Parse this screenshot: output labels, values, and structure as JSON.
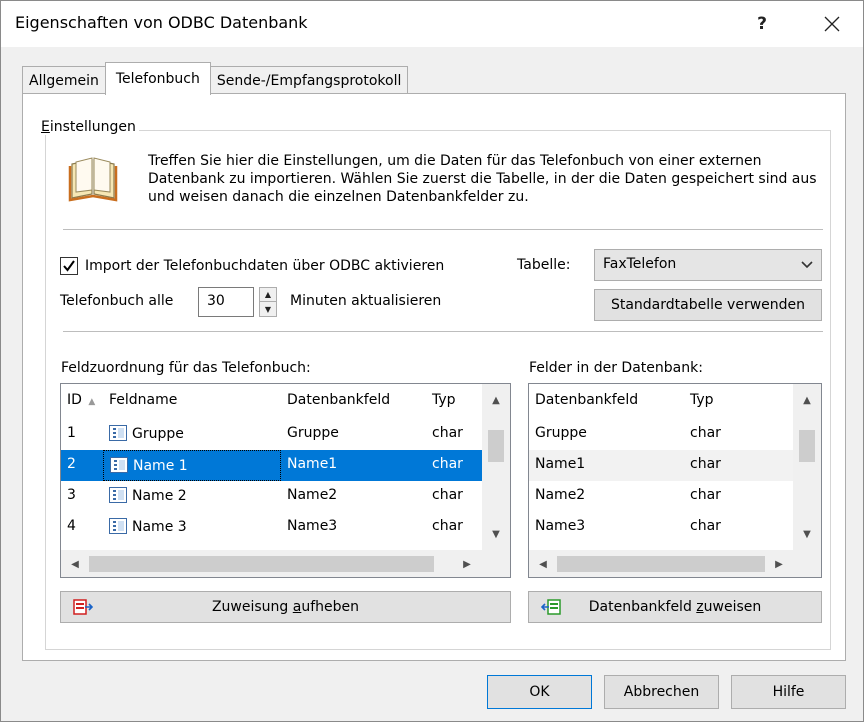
{
  "window": {
    "title": "Eigenschaften von ODBC Datenbank",
    "help_glyph": "?",
    "close_glyph": "✕"
  },
  "tabs": [
    {
      "label": "Allgemein",
      "active": false
    },
    {
      "label": "Telefonbuch",
      "active": true
    },
    {
      "label": "Sende-/Empfangsprotokoll",
      "active": false
    }
  ],
  "settings": {
    "group_title": "Einstellungen",
    "description": "Treffen Sie hier die Einstellungen, um die Daten für das Telefonbuch von einer externen Datenbank zu importieren. Wählen Sie zuerst die Tabelle, in der die Daten gespeichert sind aus und weisen danach die einzelnen Datenbankfelder zu.",
    "import_checkbox_label": "Import der Telefonbuchdaten über ODBC aktivieren",
    "import_checked": true,
    "refresh_prefix": "Telefonbuch alle",
    "refresh_minutes": "30",
    "refresh_suffix": "Minuten aktualisieren",
    "table_label": "Tabelle:",
    "table_value": "FaxTelefon",
    "default_table_button": "Standardtabelle verwenden"
  },
  "mapping": {
    "label": "Feldzuordnung für das Telefonbuch:",
    "columns": [
      "ID",
      "Feldname",
      "Datenbankfeld",
      "Typ"
    ],
    "rows": [
      {
        "id": "1",
        "fieldname": "Gruppe",
        "dbfield": "Gruppe",
        "type": "char",
        "selected": false
      },
      {
        "id": "2",
        "fieldname": "Name 1",
        "dbfield": "Name1",
        "type": "char",
        "selected": true
      },
      {
        "id": "3",
        "fieldname": "Name 2",
        "dbfield": "Name2",
        "type": "char",
        "selected": false
      },
      {
        "id": "4",
        "fieldname": "Name 3",
        "dbfield": "Name3",
        "type": "char",
        "selected": false
      }
    ],
    "unassign_button_pre": "Zuweisung ",
    "unassign_button_ul": "a",
    "unassign_button_post": "ufheben"
  },
  "dbfields": {
    "label": "Felder in der Datenbank:",
    "columns": [
      "Datenbankfeld",
      "Typ"
    ],
    "rows": [
      {
        "dbfield": "Gruppe",
        "type": "char"
      },
      {
        "dbfield": "Name1",
        "type": "char"
      },
      {
        "dbfield": "Name2",
        "type": "char"
      },
      {
        "dbfield": "Name3",
        "type": "char"
      }
    ],
    "assign_button_pre": "Datenbankfeld ",
    "assign_button_ul": "z",
    "assign_button_post": "uweisen"
  },
  "footer": {
    "ok": "OK",
    "cancel": "Abbrechen",
    "help": "Hilfe"
  },
  "colors": {
    "selection": "#0078d7",
    "dialog_bg": "#f0f0f0"
  }
}
